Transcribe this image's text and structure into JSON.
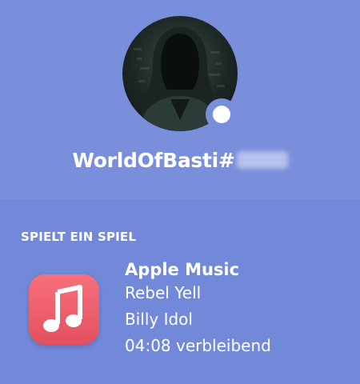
{
  "profile": {
    "username": "WorldOfBasti#",
    "status": "online",
    "avatar": {
      "description_icon": "hooded-figure-avatar"
    }
  },
  "activity": {
    "section_title": "SPIELT EIN SPIEL",
    "app_name": "Apple Music",
    "details": "Rebel Yell",
    "state": "Billy Idol",
    "time_remaining": "04:08 verbleibend",
    "icon": "music-note-icon"
  },
  "colors": {
    "background": "#7289da",
    "header": "#7a8fdc",
    "app_icon": "#ef5c6b",
    "text": "#ffffff"
  }
}
